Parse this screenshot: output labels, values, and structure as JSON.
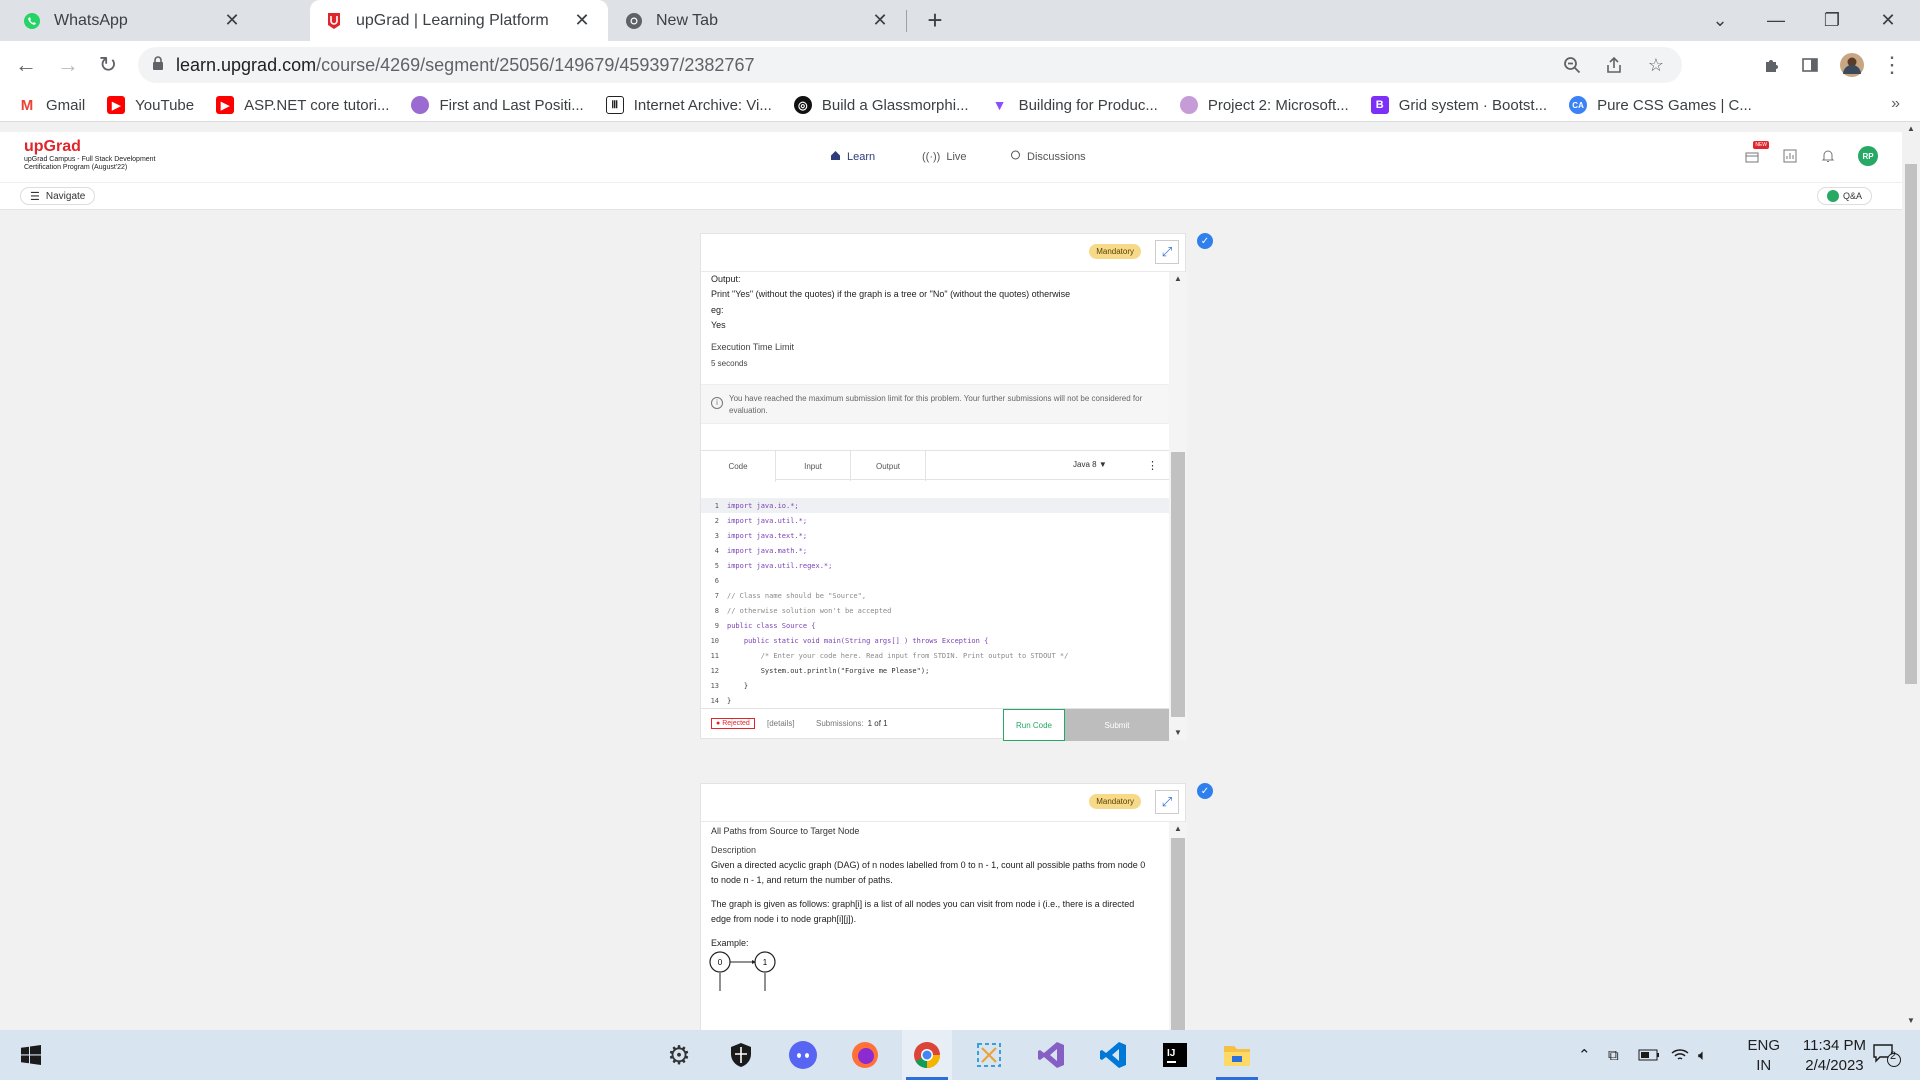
{
  "browser": {
    "tabs": [
      {
        "title": "WhatsApp",
        "icon": "whatsapp-icon"
      },
      {
        "title": "upGrad | Learning Platform",
        "icon": "upgrad-icon",
        "active": true
      },
      {
        "title": "New Tab",
        "icon": "chrome-icon"
      }
    ],
    "new_tab": "+",
    "url_host": "learn.upgrad.com",
    "url_path": "/course/4269/segment/25056/149679/459397/2382767",
    "bookmarks": [
      {
        "label": "Gmail",
        "color": "#ea4335",
        "glyph": "M"
      },
      {
        "label": "YouTube",
        "color": "#ff0000",
        "glyph": "▶"
      },
      {
        "label": "ASP.NET core tutori...",
        "color": "#ff0000",
        "glyph": "▶"
      },
      {
        "label": "First and Last Positi...",
        "color": "#9b6bd1",
        "glyph": "●"
      },
      {
        "label": "Internet Archive: Vi...",
        "color": "#222222",
        "glyph": "Ⅲ"
      },
      {
        "label": "Build a Glassmorphi...",
        "color": "#111111",
        "glyph": "◎"
      },
      {
        "label": "Building for Produc...",
        "color": "#8a4dff",
        "glyph": "▼"
      },
      {
        "label": "Project 2: Microsoft...",
        "color": "#c59bd8",
        "glyph": "●"
      },
      {
        "label": "Grid system · Bootst...",
        "color": "#7b2ff7",
        "glyph": "B"
      },
      {
        "label": "Pure CSS Games | C...",
        "color": "#3b82f6",
        "glyph": "CA"
      }
    ],
    "bookmarks_more": "»"
  },
  "site": {
    "brand": "upGrad",
    "program": "upGrad Campus - Full Stack Development Certification Program (August'22)",
    "nav": [
      {
        "label": "Learn",
        "icon": "home-icon"
      },
      {
        "label": "Live",
        "icon": "broadcast-icon"
      },
      {
        "label": "Discussions",
        "icon": "chat-icon"
      }
    ],
    "new_badge": "NEW",
    "avatar": "RP",
    "navigate": "Navigate",
    "qa": "Q&A"
  },
  "card1": {
    "mandatory": "Mandatory",
    "output_heading": "Output:",
    "output_desc": "Print \"Yes\" (without the quotes) if the graph is a tree or \"No\" (without the quotes) otherwise",
    "eg": "eg:",
    "eg_value": "Yes",
    "exec_label": "Execution Time Limit",
    "exec_value": "5 seconds",
    "notice": "You have reached the maximum submission limit for this problem. Your further submissions will not be considered for evaluation.",
    "tabs": [
      "Code",
      "Input",
      "Output"
    ],
    "language": "Java 8",
    "code_lines": [
      "import java.io.*;",
      "import java.util.*;",
      "import java.text.*;",
      "import java.math.*;",
      "import java.util.regex.*;",
      "",
      "// Class name should be \"Source\",",
      "// otherwise solution won't be accepted",
      "public class Source {",
      "    public static void main(String args[] ) throws Exception {",
      "        /* Enter your code here. Read input from STDIN. Print output to STDOUT */",
      "        System.out.println(\"Forgive me Please\");",
      "    }",
      "}"
    ],
    "status": "Rejected",
    "details": "[details]",
    "submissions_label": "Submissions:",
    "submissions_value": "1 of 1",
    "run": "Run Code",
    "submit": "Submit"
  },
  "card2": {
    "mandatory": "Mandatory",
    "title": "All Paths from Source to Target Node",
    "desc_heading": "Description",
    "desc1": "Given a directed acyclic graph (DAG) of n nodes labelled from 0 to n - 1, count all possible paths from node 0 to node n - 1, and return the number of paths.",
    "desc2": "The graph is given as follows: graph[i] is a list of all nodes you can visit from node i (i.e., there is a directed edge from node i to node graph[i][j]).",
    "example": "Example:",
    "nodes": [
      "0",
      "1"
    ]
  },
  "taskbar": {
    "apps": [
      "settings-icon",
      "security-icon",
      "discord-icon",
      "firefox-icon",
      "chrome-icon",
      "snip-icon",
      "visual-studio-icon",
      "vscode-icon",
      "intellij-icon",
      "file-explorer-icon"
    ],
    "lang_top": "ENG",
    "lang_bottom": "IN",
    "time": "11:34 PM",
    "date": "2/4/2023",
    "notifications": "2"
  }
}
